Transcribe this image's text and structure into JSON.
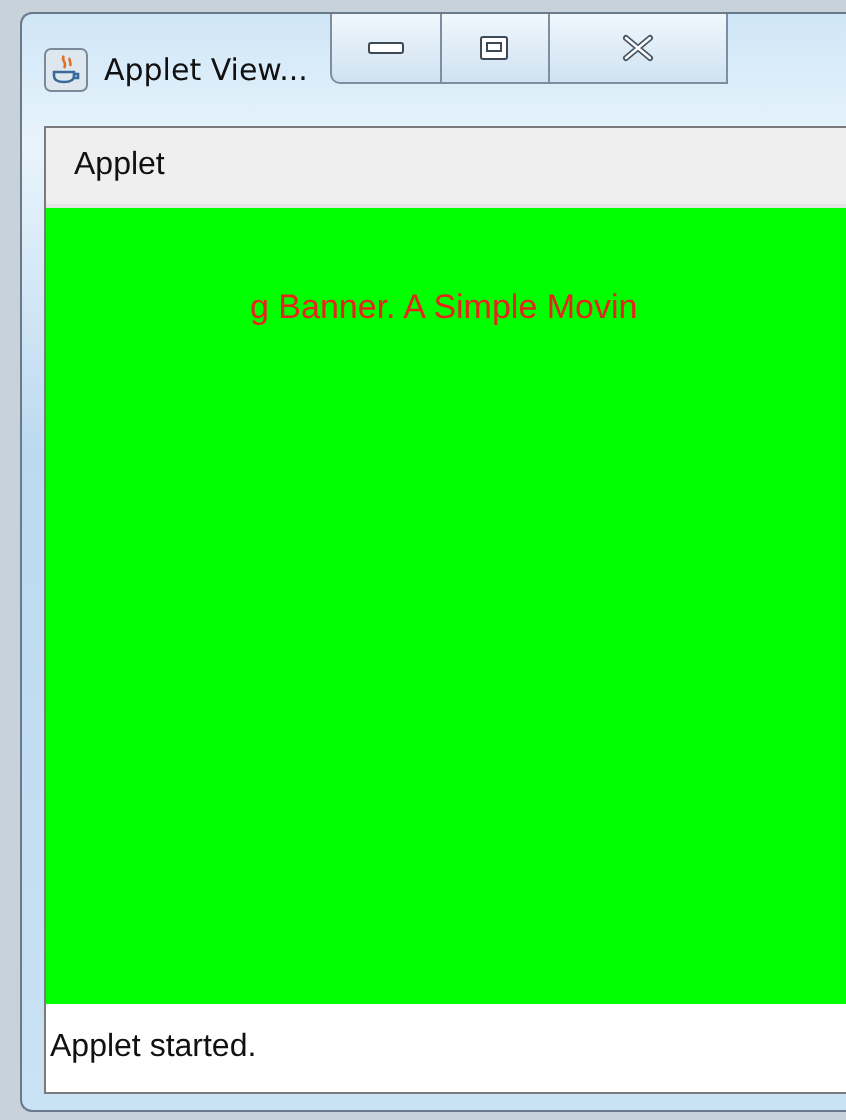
{
  "window": {
    "title": "Applet View..."
  },
  "menu_bar": {
    "items": [
      "Applet"
    ]
  },
  "applet": {
    "banner": "g Banner. A Simple Movin"
  },
  "status_bar": {
    "text": "Applet started."
  }
}
